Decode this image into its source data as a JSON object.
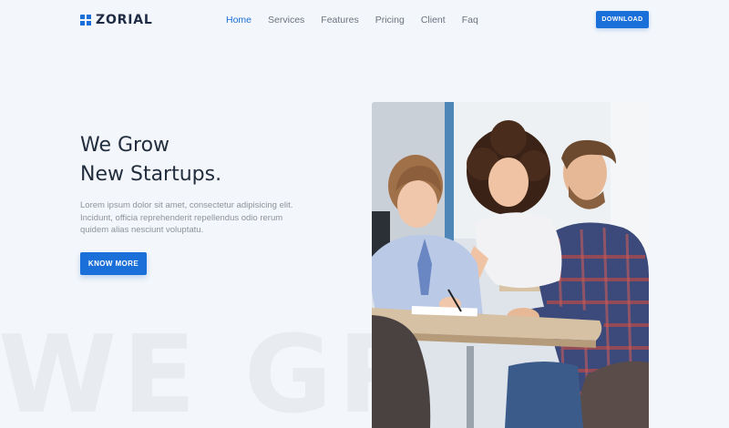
{
  "brand": {
    "name": "ZORIAL",
    "icon": "grid-logo-icon",
    "accent": "#1a6fd8"
  },
  "nav": {
    "items": [
      {
        "label": "Home",
        "active": true
      },
      {
        "label": "Services",
        "active": false
      },
      {
        "label": "Features",
        "active": false
      },
      {
        "label": "Pricing",
        "active": false
      },
      {
        "label": "Client",
        "active": false
      },
      {
        "label": "Faq",
        "active": false
      }
    ]
  },
  "header": {
    "download_label": "DOWNLOAD"
  },
  "hero": {
    "title_line1": "We Grow",
    "title_line2": "New Startups.",
    "description": "Lorem ipsum dolor sit amet, consectetur adipisicing elit. Incidunt, officia reprehenderit repellendus odio rerum quidem alias nesciunt voluptatu.",
    "cta_label": "KNOW MORE",
    "watermark": "WE GR",
    "image": "people-working-at-table-photo"
  },
  "colors": {
    "primary": "#1a6fd8",
    "heading": "#222d3d",
    "text": "#8d939c",
    "background": "#f3f6fa"
  }
}
